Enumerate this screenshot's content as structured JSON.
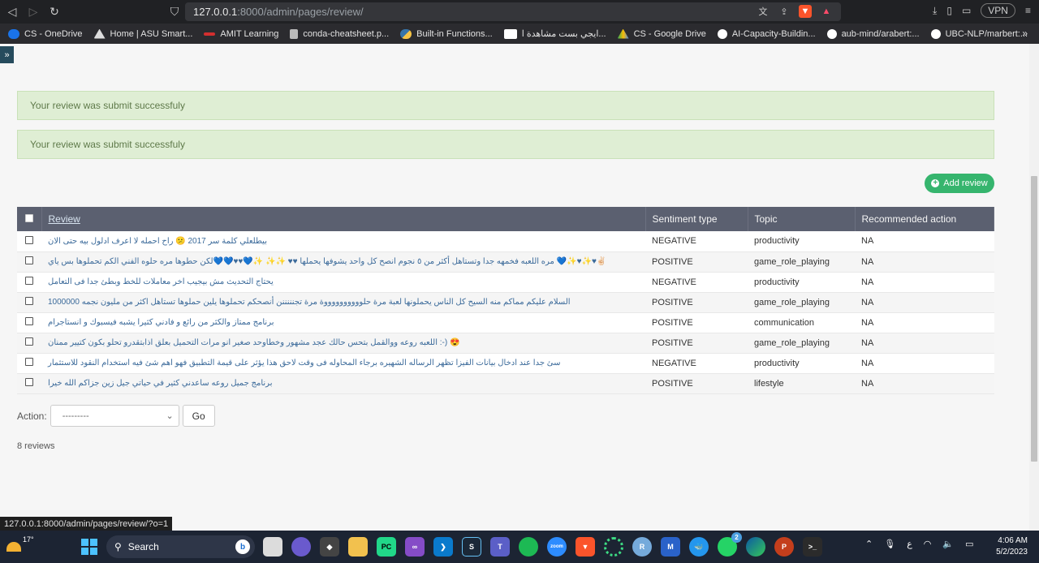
{
  "browser": {
    "url_host": "127.0.0.1",
    "url_path": ":8000/admin/pages/review/",
    "vpn_label": "VPN",
    "bookmarks": [
      {
        "label": "CS - OneDrive",
        "color": "#1a73e8"
      },
      {
        "label": "Home | ASU Smart...",
        "color": "#ffffff"
      },
      {
        "label": "AMIT Learning",
        "color": "#d32f2f"
      },
      {
        "label": "conda-cheatsheet.p...",
        "color": "#bbbbbb"
      },
      {
        "label": "Built-in Functions...",
        "color": "#f6c445"
      },
      {
        "label": "ايجي بست مشاهدة ا...",
        "color": "#ffffff"
      },
      {
        "label": "CS - Google Drive",
        "color": "#34a853"
      },
      {
        "label": "AI-Capacity-Buildin...",
        "color": "#ffffff"
      },
      {
        "label": "aub-mind/arabert:...",
        "color": "#ffffff"
      },
      {
        "label": "UBC-NLP/marbert:...",
        "color": "#ffffff"
      }
    ],
    "bookmarks_more": "»",
    "status_url": "127.0.0.1:8000/admin/pages/review/?o=1"
  },
  "page": {
    "nav_toggle": "»",
    "messages": [
      "Your review was submit successfuly",
      "Your review was submit successfuly"
    ],
    "add_button": "Add review",
    "table": {
      "headers": [
        "Review",
        "Sentiment type",
        "Topic",
        "Recommended action"
      ],
      "rows": [
        {
          "review": "بيطلعلي كلمة سر 2017 😕 راح احمله لا اعرف ادلول بيه حتى الان",
          "sentiment": "NEGATIVE",
          "topic": "productivity",
          "action": "NA"
        },
        {
          "review": "✌🏻♥✨♥✨💙 مره اللعبه فخمهه جدا وتستاهل أكثر من ٥ نجوم انصح كل واحد يشوفها يحملها ♥♥ ✨✨ ✨💙♥♥💙💙لكن حطوها مره حلوه الفني الكم تحملوها بس ياي",
          "sentiment": "POSITIVE",
          "topic": "game_role_playing",
          "action": "NA"
        },
        {
          "review": "يحتاج التحديث مش بيجيب اخر معاملات للخط وبطئ جدا فى التعامل",
          "sentiment": "NEGATIVE",
          "topic": "productivity",
          "action": "NA"
        },
        {
          "review": "السلام عليكم مماكم منه السيح كل الناس يحملونها لعبة مرة حلووووووووووة مرة تجنننننن أنصحكم تحملوها يلين حملوها تستاهل اكثر من مليون نجمه 1000000",
          "sentiment": "POSITIVE",
          "topic": "game_role_playing",
          "action": "NA"
        },
        {
          "review": "برنامج ممتاز والكثر من رائع و فادني كثيرا يشبه فيسبوك و انستاجرام",
          "sentiment": "POSITIVE",
          "topic": "communication",
          "action": "NA"
        },
        {
          "review": "😍 (-: اللعبه روعه ووالقمل بتحس حالك عجد مشهور وخطاوحد صغير انو مرات التحميل بعلق اذابتقدرو تحلو بكون كتيير ممنان",
          "sentiment": "POSITIVE",
          "topic": "game_role_playing",
          "action": "NA"
        },
        {
          "review": "سئ جدا عند ادخال بيانات الفيزا تظهر الرساله الشهيره برجاء المحاوله فى وقت لاحق هذا يؤثر على قيمة التطبيق فهو اهم شئ فيه استخدام النقود للاستثمار",
          "sentiment": "NEGATIVE",
          "topic": "productivity",
          "action": "NA"
        },
        {
          "review": "برنامج جميل روعه ساعدني كثير في حياتي جيل زين جزاكم الله خيرا",
          "sentiment": "POSITIVE",
          "topic": "lifestyle",
          "action": "NA"
        }
      ]
    },
    "action_label": "Action:",
    "action_select_value": "---------",
    "go_button": "Go",
    "count_text": "8 reviews"
  },
  "taskbar": {
    "temperature": "17°",
    "search_label": "Search",
    "time": "4:06 AM",
    "date": "5/2/2023",
    "whatsapp_badge": "2",
    "lang": "ع",
    "icons": [
      "file-explorer-icon",
      "chat-icon",
      "unity-icon",
      "folder-icon",
      "pycharm-icon",
      "visual-studio-icon",
      "vscode-icon",
      "steam-icon",
      "teams-icon",
      "spotify-icon",
      "zoom-icon",
      "brave-icon",
      "spinner-app-icon",
      "r-icon",
      "math-icon",
      "docker-icon",
      "whatsapp-icon",
      "edge-icon",
      "powerpoint-icon",
      "terminal-icon"
    ]
  }
}
